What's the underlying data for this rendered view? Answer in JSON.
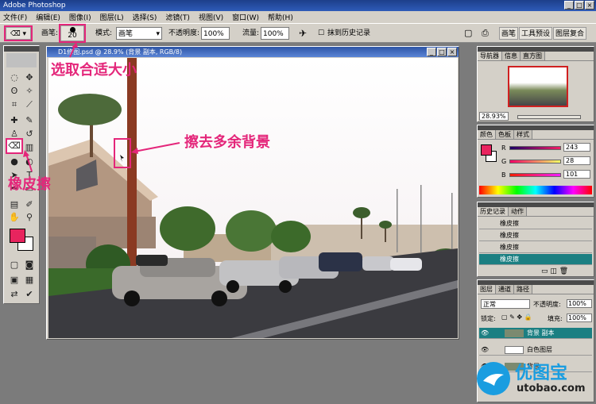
{
  "window": {
    "title": "Adobe Photoshop"
  },
  "menu": [
    "文件(F)",
    "编辑(E)",
    "图像(I)",
    "图层(L)",
    "选择(S)",
    "滤镜(T)",
    "视图(V)",
    "窗口(W)",
    "帮助(H)"
  ],
  "options": {
    "brush_label": "画笔:",
    "brush_size": "20",
    "mode_label": "模式:",
    "mode_value": "画笔",
    "opacity_label": "不透明度:",
    "opacity_value": "100%",
    "flow_label": "流量:",
    "flow_value": "100%",
    "history_erase_label": "抹到历史记录",
    "right_tabs": [
      "画笔",
      "工具预设",
      "图层复合"
    ]
  },
  "document": {
    "title": "D1修图.psd @ 28.9% (背景 副本, RGB/8)"
  },
  "annotations": {
    "pick_size": "选取合适大小",
    "erase_bg": "擦去多余背景",
    "eraser": "橡皮擦"
  },
  "navigator": {
    "tabs": [
      "导航器",
      "信息",
      "直方图"
    ],
    "zoom": "28.93%"
  },
  "color": {
    "tabs": [
      "颜色",
      "色板",
      "样式"
    ],
    "fg": "#e8245e",
    "r_label": "R",
    "r_value": "243",
    "g_label": "G",
    "g_value": "28",
    "b_label": "B",
    "b_value": "101"
  },
  "history": {
    "tabs": [
      "历史记录",
      "动作"
    ],
    "items": [
      "橡皮擦",
      "橡皮擦",
      "橡皮擦",
      "橡皮擦",
      "橡皮擦"
    ]
  },
  "layers": {
    "tabs": [
      "图层",
      "通道",
      "路径"
    ],
    "blend_mode": "正常",
    "opacity_label": "不透明度:",
    "opacity_value": "100%",
    "lock_label": "锁定:",
    "fill_label": "填充:",
    "fill_value": "100%",
    "items": [
      "背景 副本",
      "白色图层",
      "背景"
    ]
  },
  "watermark": {
    "name": "优图宝",
    "url": "utobao.com"
  }
}
